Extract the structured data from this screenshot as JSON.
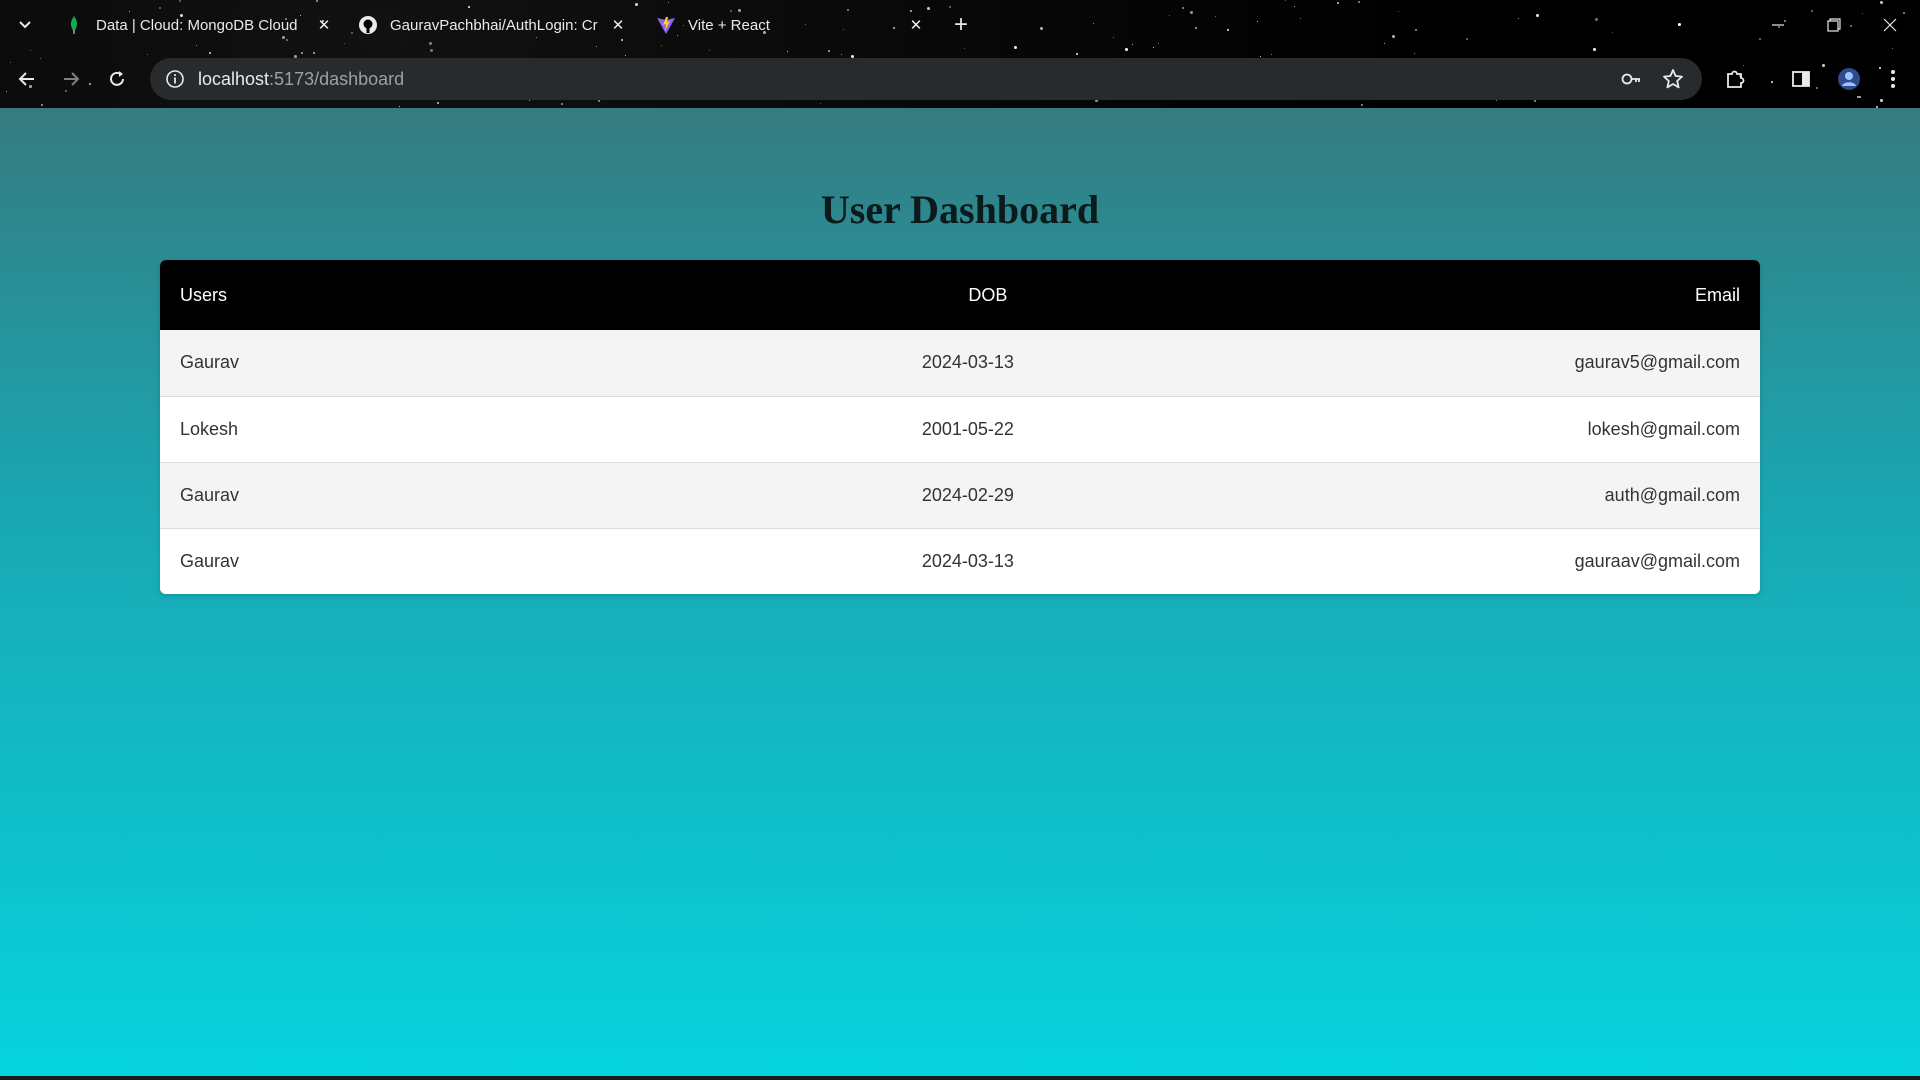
{
  "browser": {
    "tabs": [
      {
        "title": "Data | Cloud: MongoDB Cloud",
        "icon": "mongodb-leaf-icon"
      },
      {
        "title": "GauravPachbhai/AuthLogin: Cre",
        "icon": "github-icon"
      },
      {
        "title": "Vite + React",
        "icon": "vite-icon"
      }
    ],
    "url_host": "localhost",
    "url_path": ":5173/dashboard"
  },
  "page": {
    "title": "User Dashboard",
    "table": {
      "headers": [
        "Users",
        "DOB",
        "Email"
      ],
      "rows": [
        [
          "Gaurav",
          "2024-03-13",
          "gaurav5@gmail.com"
        ],
        [
          "Lokesh",
          "2001-05-22",
          "lokesh@gmail.com"
        ],
        [
          "Gaurav",
          "2024-02-29",
          "auth@gmail.com"
        ],
        [
          "Gaurav",
          "2024-03-13",
          "gauraav@gmail.com"
        ]
      ]
    }
  },
  "colors": {
    "header_bg": "#000000",
    "gradient_top": "#357b80",
    "gradient_bottom": "#06d3dd"
  }
}
